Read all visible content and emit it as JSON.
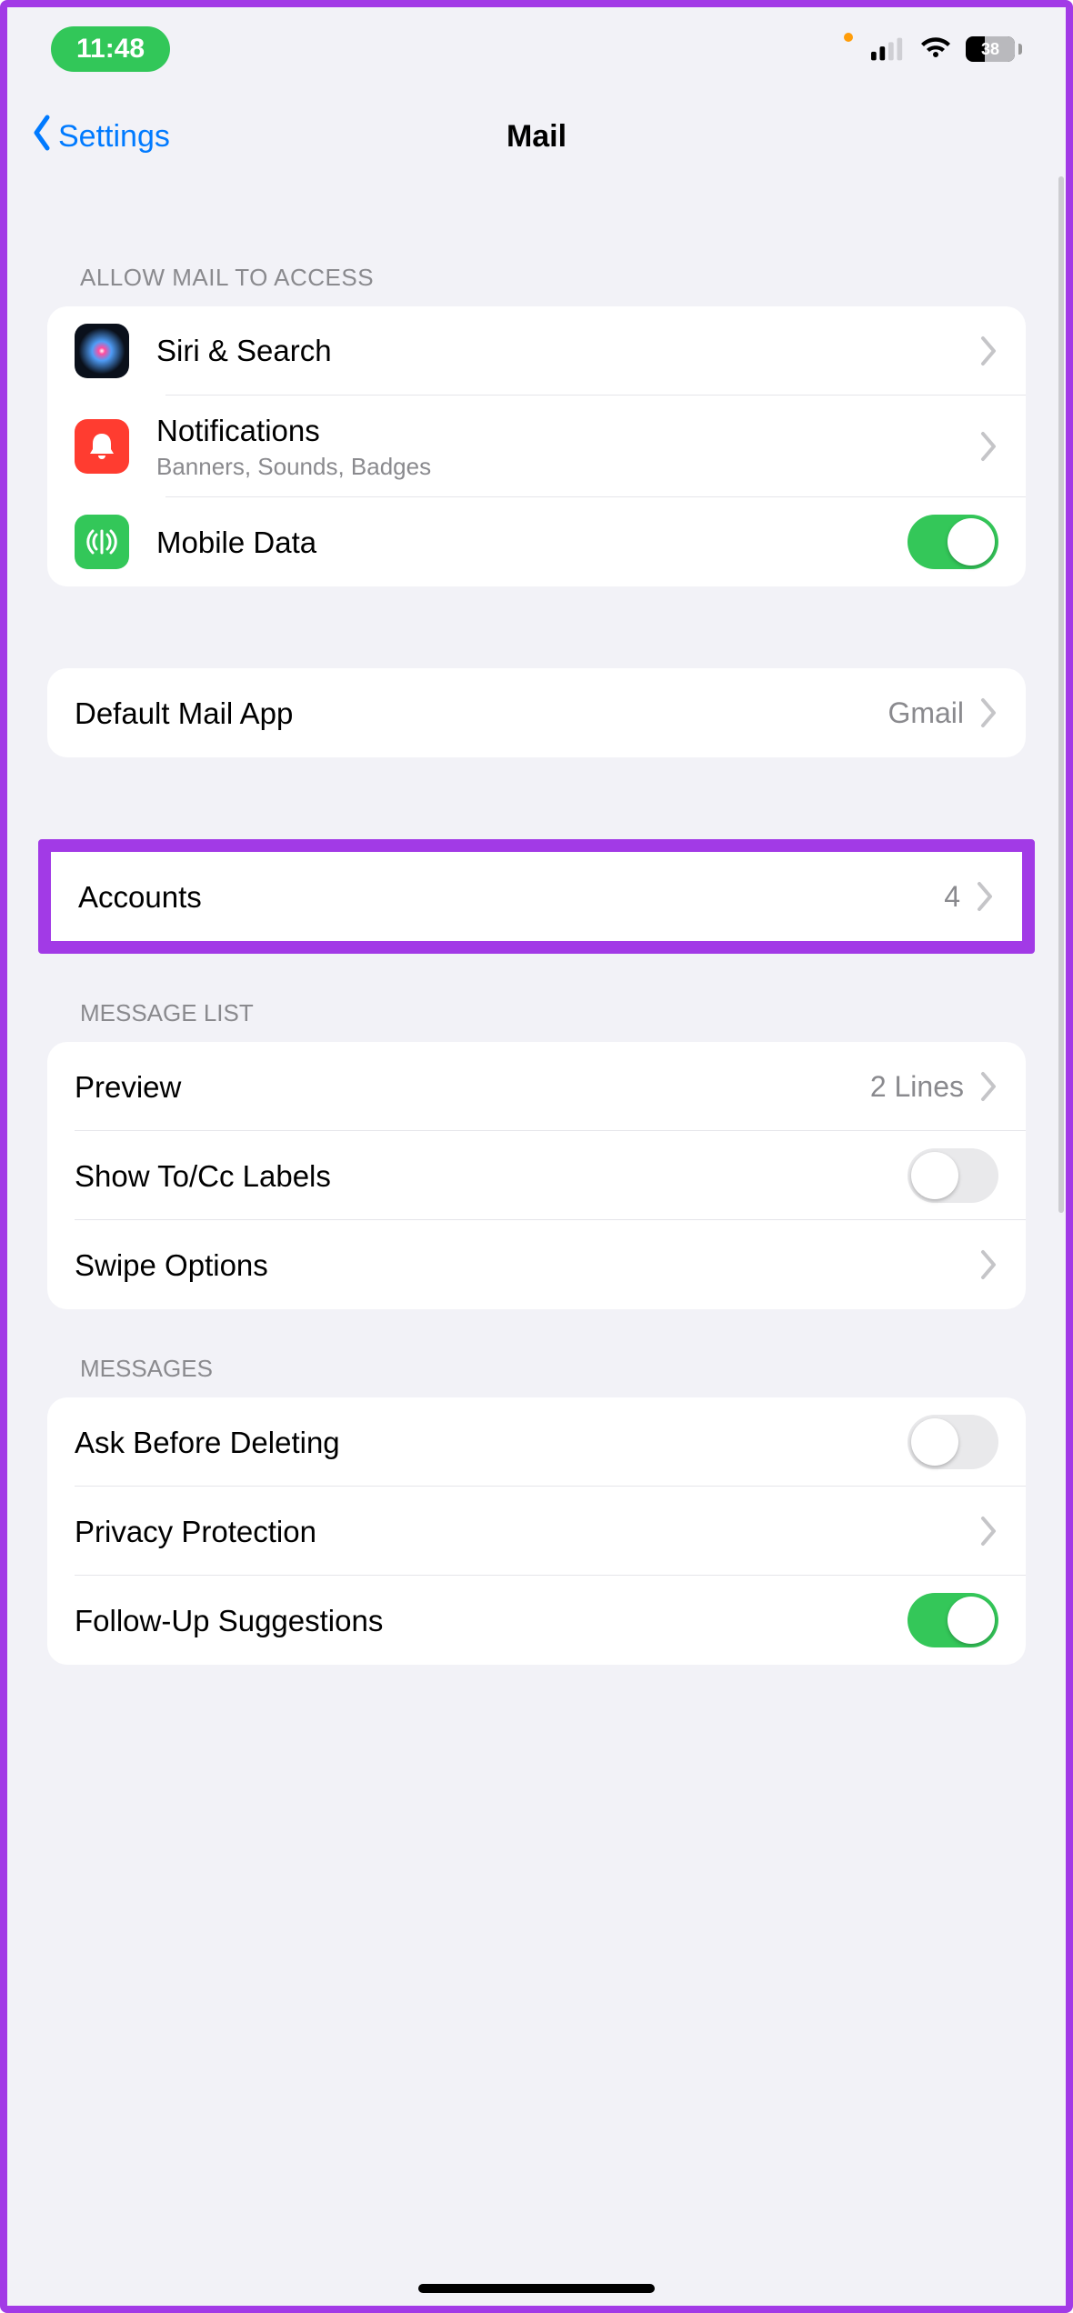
{
  "statusbar": {
    "time": "11:48",
    "battery_text": "38"
  },
  "nav": {
    "back_label": "Settings",
    "title": "Mail"
  },
  "sections": {
    "allow_access_header": "ALLOW MAIL TO ACCESS",
    "siri_search_label": "Siri & Search",
    "notifications_label": "Notifications",
    "notifications_sub": "Banners, Sounds, Badges",
    "mobile_data_label": "Mobile Data",
    "mobile_data_on": true,
    "default_mail_label": "Default Mail App",
    "default_mail_value": "Gmail",
    "accounts_label": "Accounts",
    "accounts_value": "4",
    "message_list_header": "MESSAGE LIST",
    "preview_label": "Preview",
    "preview_value": "2 Lines",
    "show_tocc_label": "Show To/Cc Labels",
    "show_tocc_on": false,
    "swipe_options_label": "Swipe Options",
    "messages_header": "MESSAGES",
    "ask_before_deleting_label": "Ask Before Deleting",
    "ask_before_deleting_on": false,
    "privacy_protection_label": "Privacy Protection",
    "followup_label": "Follow-Up Suggestions",
    "followup_on": true
  }
}
